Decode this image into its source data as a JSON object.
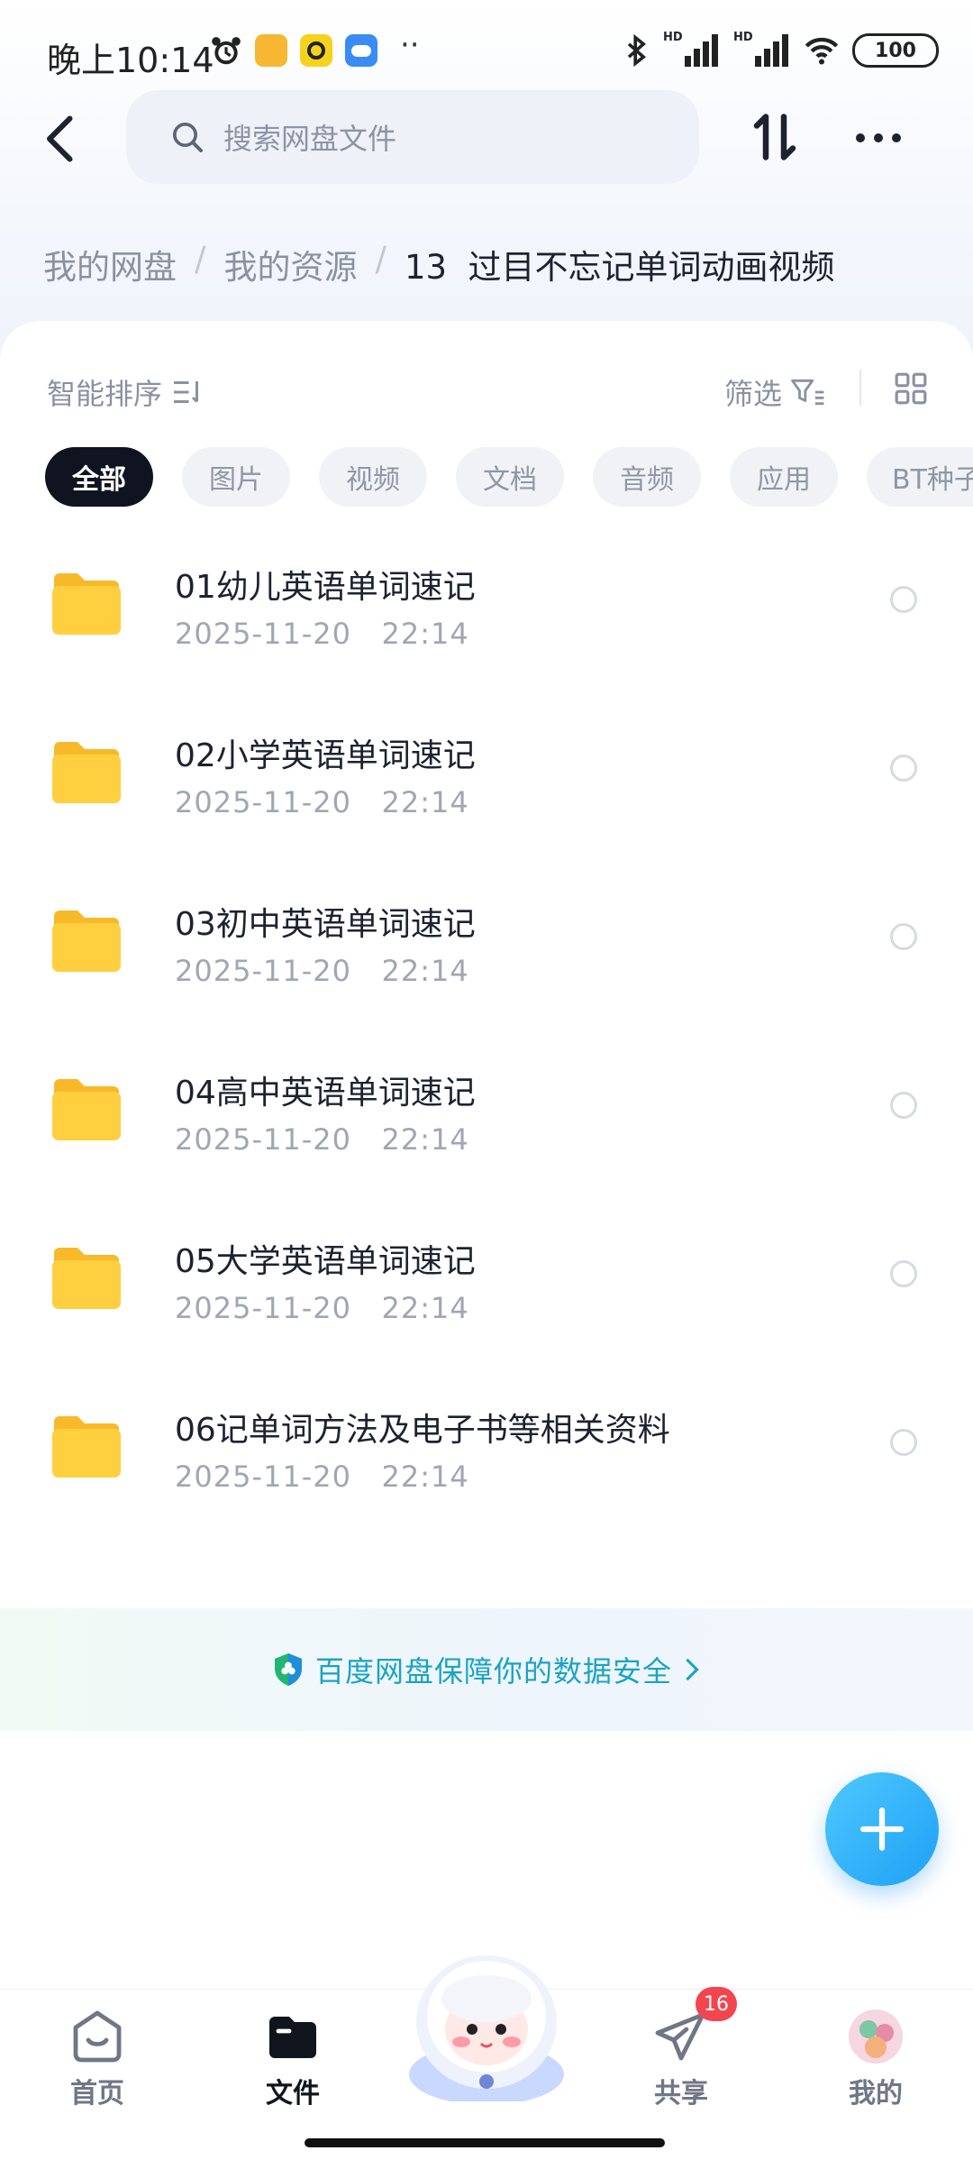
{
  "status_bar": {
    "time": "晚上10:14",
    "dots": "··",
    "battery": "100",
    "signal_label": "HD"
  },
  "nav": {
    "search_placeholder": "搜索网盘文件"
  },
  "breadcrumb": {
    "items": [
      "我的网盘",
      "我的资源",
      "13  过目不忘记单词动画视频"
    ],
    "separator": "/"
  },
  "toolbar": {
    "sort_label": "智能排序",
    "filter_label": "筛选"
  },
  "chips": [
    "全部",
    "图片",
    "视频",
    "文档",
    "音频",
    "应用",
    "BT种子"
  ],
  "files": [
    {
      "name": "01幼儿英语单词速记",
      "date": "2025-11-20   22:14"
    },
    {
      "name": "02小学英语单词速记",
      "date": "2025-11-20   22:14"
    },
    {
      "name": "03初中英语单词速记",
      "date": "2025-11-20   22:14"
    },
    {
      "name": "04高中英语单词速记",
      "date": "2025-11-20   22:14"
    },
    {
      "name": "05大学英语单词速记",
      "date": "2025-11-20   22:14"
    },
    {
      "name": "06记单词方法及电子书等相关资料",
      "date": "2025-11-20   22:14"
    }
  ],
  "banner": {
    "text": "百度网盘保障你的数据安全"
  },
  "bottom_nav": {
    "items": [
      {
        "label": "首页",
        "icon": "home-icon",
        "active": false
      },
      {
        "label": "文件",
        "icon": "folder-icon",
        "active": true
      },
      {
        "label": "共享",
        "icon": "send-icon",
        "active": false
      },
      {
        "label": "我的",
        "icon": "avatar-icon",
        "active": false
      }
    ],
    "share_badge": "16"
  },
  "colors": {
    "accent": "#1ea0f5",
    "folder": "#ffc93a",
    "badge": "#f1464f",
    "banner_text": "#1aa3c4"
  }
}
